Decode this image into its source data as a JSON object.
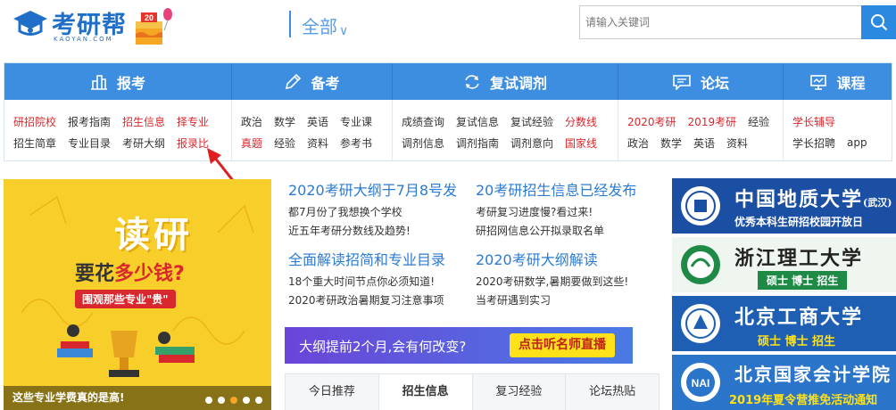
{
  "header": {
    "logo_text": "考研帮",
    "logo_sub": "KAOYAN.COM",
    "badge": "20",
    "category": "全部",
    "search_placeholder": "请输入关键词"
  },
  "nav": {
    "tabs": [
      {
        "label": "报考",
        "icon": "building-icon"
      },
      {
        "label": "备考",
        "icon": "pencil-icon"
      },
      {
        "label": "复试调剂",
        "icon": "refresh-icon"
      },
      {
        "label": "论坛",
        "icon": "chat-icon"
      },
      {
        "label": "课程",
        "icon": "board-icon"
      }
    ],
    "columns": [
      {
        "rows": [
          [
            {
              "t": "研招院校",
              "red": true
            },
            {
              "t": "报考指南"
            },
            {
              "t": "招生信息",
              "red": true
            },
            {
              "t": "择专业",
              "red": true
            }
          ],
          [
            {
              "t": "招生简章"
            },
            {
              "t": "专业目录"
            },
            {
              "t": "考研大纲"
            },
            {
              "t": "报录比",
              "red": true
            }
          ]
        ]
      },
      {
        "rows": [
          [
            {
              "t": "政治"
            },
            {
              "t": "数学"
            },
            {
              "t": "英语"
            },
            {
              "t": "专业课"
            }
          ],
          [
            {
              "t": "真题",
              "red": true
            },
            {
              "t": "经验"
            },
            {
              "t": "资料"
            },
            {
              "t": "参考书"
            }
          ]
        ]
      },
      {
        "rows": [
          [
            {
              "t": "成绩查询"
            },
            {
              "t": "复试信息"
            },
            {
              "t": "复试经验"
            },
            {
              "t": "分数线",
              "red": true
            }
          ],
          [
            {
              "t": "调剂信息"
            },
            {
              "t": "调剂指南"
            },
            {
              "t": "调剂意向"
            },
            {
              "t": "国家线",
              "red": true
            }
          ]
        ]
      },
      {
        "rows": [
          [
            {
              "t": "2020考研",
              "red": true
            },
            {
              "t": "2019考研",
              "red": true
            },
            {
              "t": "经验"
            }
          ],
          [
            {
              "t": "政治"
            },
            {
              "t": "数学"
            },
            {
              "t": "英语"
            },
            {
              "t": "资料"
            }
          ]
        ]
      },
      {
        "rows": [
          [
            {
              "t": "学长辅导",
              "red": true
            }
          ],
          [
            {
              "t": "学长招聘"
            },
            {
              "t": "app"
            }
          ]
        ]
      }
    ]
  },
  "banner": {
    "title": "读研",
    "line2_a": "要花",
    "line2_b": "多少钱?",
    "line3": "围观那些专业\"贵\"",
    "caption": "这些专业学费真的是高!",
    "dots": 5,
    "active_dot": 3
  },
  "news": {
    "left": [
      {
        "head": "2020考研大纲于7月8号发",
        "items": [
          "都7月份了我想换个学校",
          "近五年考研分数线及趋势!"
        ]
      },
      {
        "head": "全面解读招简和专业目录",
        "items": [
          "18个重大时间节点你必须知道!",
          "2020考研政治暑期复习注意事项"
        ]
      }
    ],
    "right": [
      {
        "head": "20考研招生信息已经发布",
        "items": [
          "考研复习进度慢?看过来!",
          "研招网信息公开拟录取名单"
        ]
      },
      {
        "head": "2020考研大纲解读",
        "items": [
          "2020考研数学,暑期要做到这些!",
          "当考研遇到实习"
        ]
      }
    ],
    "ad_text": "大纲提前2个月,会有何改变?",
    "ad_button": "点击听名师直播",
    "tabs": [
      "今日推荐",
      "招生信息",
      "复习经验",
      "论坛热贴"
    ],
    "active_tab": 1
  },
  "ads": [
    {
      "name": "中国地质大学",
      "tag": "(武汉)",
      "sub": "优秀本科生研招校园开放日",
      "bg": "#1b4fa3"
    },
    {
      "name": "浙江理工大学",
      "sub": "硕士  博士  招生",
      "bg": "#1f8a46"
    },
    {
      "name": "北京工商大学",
      "sub": "硕士  博士  招生",
      "bg": "#1e5fb3"
    },
    {
      "name": "北京国家会计学院",
      "sub": "2019年夏令营推免活动通知",
      "bg": "#2a74c9"
    }
  ]
}
